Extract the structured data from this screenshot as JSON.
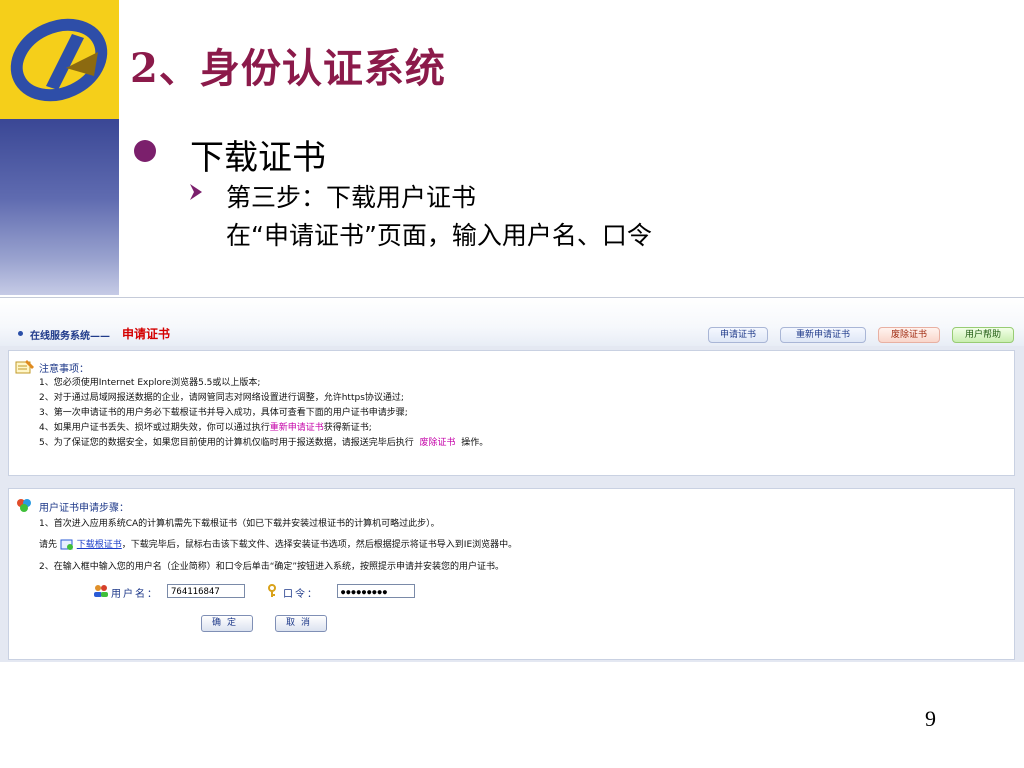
{
  "slide": {
    "title": "2、身份认证系统",
    "bullet": "下载证书",
    "sub_step": "第三步：下载用户证书",
    "sub_detail": "在“申请证书”页面，输入用户名、口令",
    "page_number": "9"
  },
  "web": {
    "header": {
      "site_label": "在线服务系统——",
      "page_title": "申请证书",
      "nav": [
        "申请证书",
        "重新申请证书",
        "废除证书",
        "用户帮助"
      ]
    },
    "notice": {
      "heading": "注意事项：",
      "lines": [
        "1、您必须使用Internet Explore浏览器5.5或以上版本;",
        "2、对于通过局域网报送数据的企业，请网管同志对网络设置进行调整，允许https协议通过;",
        "3、第一次申请证书的用户务必下载根证书并导入成功，具体可查看下面的用户证书申请步骤;"
      ],
      "line4_pre": "4、如果用户证书丢失、损坏或过期失效，你可以通过执行",
      "line4_link": "重新申请证书",
      "line4_post": "获得新证书;",
      "line5_pre": "5、为了保证您的数据安全，如果您目前使用的计算机仅临时用于报送数据，请报送完毕后执行",
      "line5_link": "废除证书",
      "line5_post": "操作。"
    },
    "steps": {
      "heading": "用户证书申请步骤：",
      "step1": "1、首次进入应用系统CA的计算机需先下载根证书（如已下载并安装过根证书的计算机可略过此步）。",
      "step1b_pre": "请先",
      "step1b_link": "下载根证书",
      "step1b_post": "，下载完毕后，鼠标右击该下载文件、选择安装证书选项，然后根据提示将证书导入到IE浏览器中。",
      "step2": "2、在输入框中输入您的用户名（企业简称）和口令后单击“确定”按钮进入系统，按照提示申请并安装您的用户证书。"
    },
    "form": {
      "username_label": "用户名：",
      "username_value": "764116847",
      "password_label": "口令：",
      "password_value": "●●●●●●●●●",
      "ok_label": "确定",
      "cancel_label": "取消"
    }
  },
  "colors": {
    "title": "#8b1a4a",
    "bullet": "#7b1f6c",
    "logo_yellow": "#f5cf1a",
    "band_blue": "#3a4795",
    "accent_red": "#d40000",
    "link_pink": "#c400a8"
  }
}
